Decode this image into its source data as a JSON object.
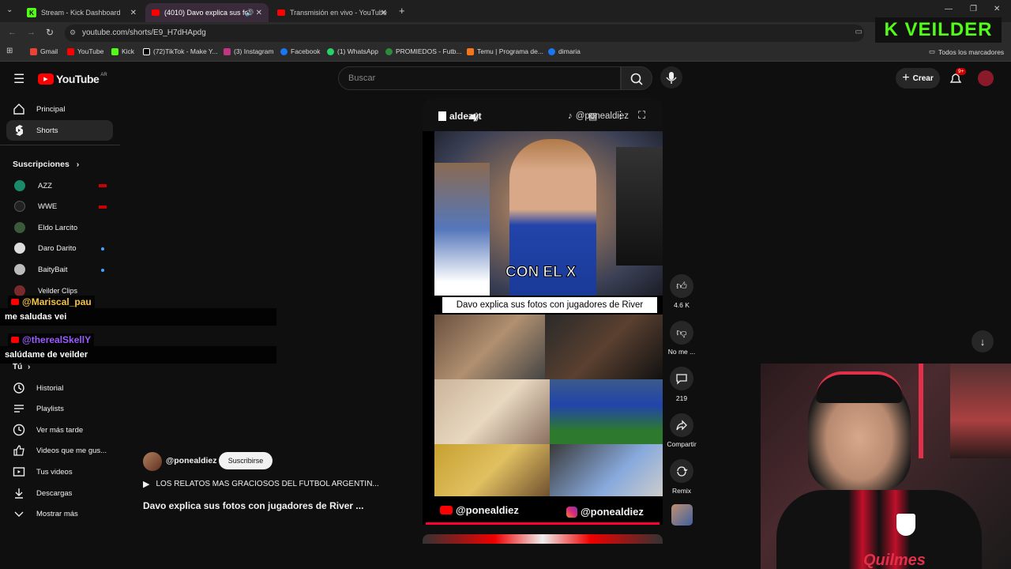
{
  "browser": {
    "tabs": [
      {
        "title": "Stream - Kick Dashboard"
      },
      {
        "title": "(4010) Davo explica sus fot"
      },
      {
        "title": "Transmisión en vivo - YouTube"
      }
    ],
    "url": "youtube.com/shorts/E9_H7dHApdg",
    "bookmarks": [
      "Gmail",
      "YouTube",
      "Kick",
      "(72)TikTok - Make Y...",
      "(3) Instagram",
      "Facebook",
      "(1) WhatsApp",
      "PROMIEDOS - Futb...",
      "Temu | Programa de...",
      "dimaria"
    ],
    "all_bookmarks": "Todos los marcadores",
    "overlay_logo": "K VEILDER"
  },
  "header": {
    "logo": "YouTube",
    "region": "AR",
    "search_placeholder": "Buscar",
    "create_label": "Crear",
    "notif_badge": "9+"
  },
  "sidebar": {
    "main": [
      {
        "label": "Principal",
        "icon": "home-icon"
      },
      {
        "label": "Shorts",
        "icon": "shorts-icon"
      }
    ],
    "subs_title": "Suscripciones",
    "subscriptions": [
      {
        "label": "AZZ",
        "live": true
      },
      {
        "label": "WWE",
        "live": true
      },
      {
        "label": "Eldo Larcito",
        "live": false
      },
      {
        "label": "Daro Darito",
        "dot": true
      },
      {
        "label": "BaityBait",
        "dot": true
      },
      {
        "label": "Veilder Clips",
        "dot": false
      }
    ],
    "you_label": "Tú",
    "you_items": [
      {
        "label": "Historial",
        "icon": "history-icon"
      },
      {
        "label": "Playlists",
        "icon": "playlist-icon"
      },
      {
        "label": "Ver más tarde",
        "icon": "clock-icon"
      },
      {
        "label": "Videos que me gus...",
        "icon": "like-icon"
      },
      {
        "label": "Tus videos",
        "icon": "video-icon"
      },
      {
        "label": "Descargas",
        "icon": "download-icon"
      },
      {
        "label": "Mostrar más",
        "icon": "chevron-down-icon"
      }
    ]
  },
  "chat": [
    {
      "user": "@Mariscal_pau",
      "message": "me saludas vei"
    },
    {
      "user": "@therealSkellY",
      "message": "salúdame de veilder"
    }
  ],
  "short": {
    "watermark_left": "aldezyt",
    "watermark_right": "@ponealdiez",
    "overlay_text": "CON EL X",
    "caption": "Davo explica sus fotos con jugadores de River",
    "yt_handle": "@ponealdiez",
    "ig_handle": "@ponealdiez",
    "channel": "@ponealdiez",
    "subscribe_label": "Suscribirse",
    "playlist_title": "LOS RELATOS MAS GRACIOSOS DEL FUTBOL ARGENTIN...",
    "title": "Davo explica sus fotos con jugadores de River ..."
  },
  "actions": {
    "likes": "4.6 K",
    "dislike": "No me ...",
    "comments": "219",
    "share": "Compartir",
    "remix": "Remix"
  },
  "cam": {
    "jersey_text": "Quilmes"
  }
}
